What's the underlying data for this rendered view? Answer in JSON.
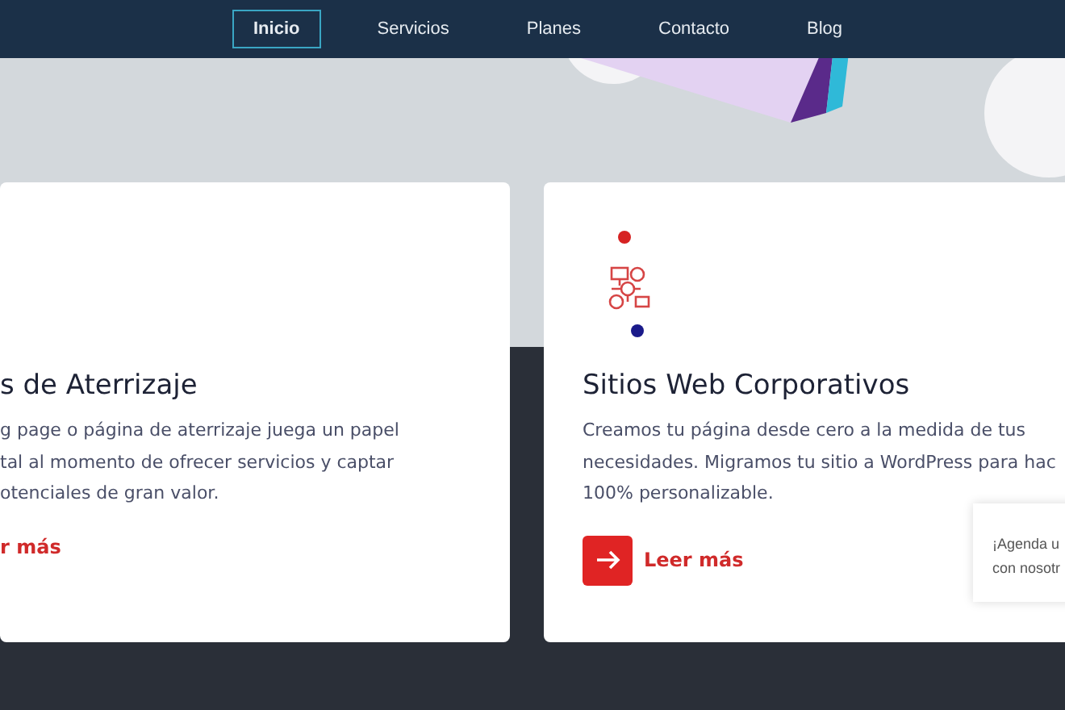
{
  "nav": [
    {
      "label": "Inicio",
      "selected": true
    },
    {
      "label": "Servicios",
      "selected": false
    },
    {
      "label": "Planes",
      "selected": false
    },
    {
      "label": "Contacto",
      "selected": false
    },
    {
      "label": "Blog",
      "selected": false
    }
  ],
  "cards": [
    {
      "kind": "plain",
      "title": "s de Aterrizaje",
      "lines": [
        "g page o página de aterrizaje juega un papel",
        "tal al momento de ofrecer servicios y captar",
        "otenciales de gran valor."
      ],
      "link": "r más"
    },
    {
      "kind": "icon",
      "title": "Sitios Web Corporativos",
      "lines": [
        "Creamos tu página desde cero a la medida de tus",
        "necesidades. Migramos tu sitio a WordPress para hac",
        "100% personalizable."
      ],
      "link": "Leer más"
    }
  ],
  "chat_popup": {
    "lines": [
      "¡Agenda u",
      "con nosotr"
    ]
  }
}
